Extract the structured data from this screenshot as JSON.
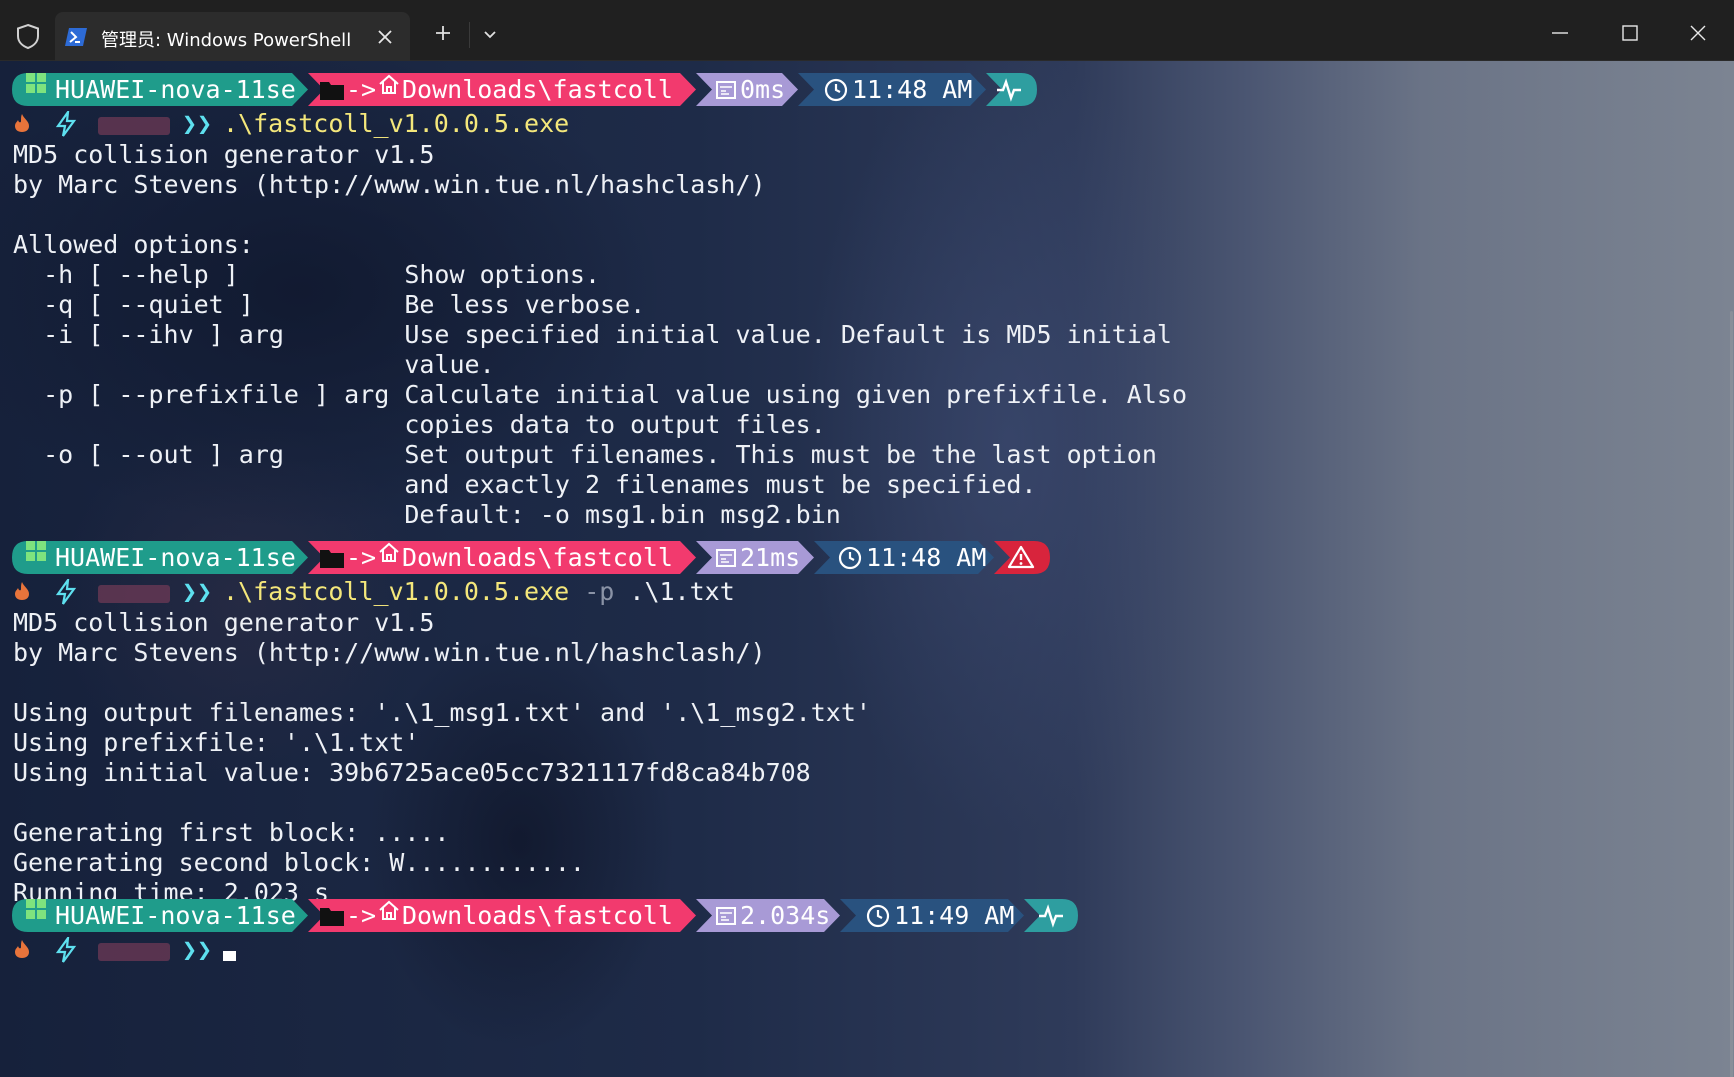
{
  "window": {
    "tab_title": "管理员: Windows PowerShell",
    "tab_icon": "powershell-icon"
  },
  "colors": {
    "host_bg": "#1f9c8b",
    "path_bg": "#f23a6e",
    "timer_bg": "#a89ad6",
    "clock_bg": "#29527f",
    "status_ok_bg": "#2e9ea0",
    "status_err_bg": "#d8243c",
    "exe": "#f4e77b",
    "chevron": "#5ee0ef"
  },
  "prompts": [
    {
      "host": "HUAWEI-nova-11se",
      "arrow": "->",
      "path": "Downloads\\fastcoll",
      "duration": "0ms",
      "time": "11:48 AM",
      "status": "ok"
    },
    {
      "host": "HUAWEI-nova-11se",
      "arrow": "->",
      "path": "Downloads\\fastcoll",
      "duration": "21ms",
      "time": "11:48 AM",
      "status": "error"
    },
    {
      "host": "HUAWEI-nova-11se",
      "arrow": "->",
      "path": "Downloads\\fastcoll",
      "duration": "2.034s",
      "time": "11:49 AM",
      "status": "ok"
    }
  ],
  "prompt_symbol": "❯❯",
  "commands": [
    {
      "exe": ".\\fastcoll_v1.0.0.5.exe",
      "flag": "",
      "arg": ""
    },
    {
      "exe": ".\\fastcoll_v1.0.0.5.exe",
      "flag": " -p",
      "arg": " .\\1.txt"
    }
  ],
  "output1": [
    "MD5 collision generator v1.5",
    "by Marc Stevens (http://www.win.tue.nl/hashclash/)",
    "",
    "Allowed options:",
    "  -h [ --help ]           Show options.",
    "  -q [ --quiet ]          Be less verbose.",
    "  -i [ --ihv ] arg        Use specified initial value. Default is MD5 initial",
    "                          value.",
    "  -p [ --prefixfile ] arg Calculate initial value using given prefixfile. Also",
    "                          copies data to output files.",
    "  -o [ --out ] arg        Set output filenames. This must be the last option",
    "                          and exactly 2 filenames must be specified.",
    "                          Default: -o msg1.bin msg2.bin"
  ],
  "output2": [
    "MD5 collision generator v1.5",
    "by Marc Stevens (http://www.win.tue.nl/hashclash/)",
    "",
    "Using output filenames: '.\\1_msg1.txt' and '.\\1_msg2.txt'",
    "Using prefixfile: '.\\1.txt'",
    "Using initial value: 39b6725ace05cc7321117fd8ca84b708",
    "",
    "Generating first block: .....",
    "Generating second block: W............",
    "Running time: 2.023 s"
  ]
}
